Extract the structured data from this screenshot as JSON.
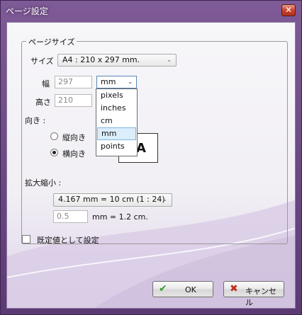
{
  "window": {
    "title": "ページ設定",
    "close_label": "✕"
  },
  "page_size": {
    "legend": "ページサイズ",
    "size_label": "サイズ",
    "size_value": "A4 :  210 x 297 mm.",
    "width_label": "幅",
    "width_value": "297",
    "height_label": "高さ",
    "height_value": "210",
    "unit_value": "mm",
    "unit_options": [
      "pixels",
      "inches",
      "cm",
      "mm",
      "points"
    ],
    "unit_selected": "mm",
    "orientation_label": "向き :",
    "portrait_label": "縦向き",
    "landscape_label": "横向き",
    "orientation_selected": "landscape",
    "preview_letter": "A",
    "scale_label": "拡大縮小 :",
    "scale_value": "4.167 mm = 10 cm (1 : 24)",
    "scale_input": "0.5",
    "scale_equation": "mm  =  1.2 cm."
  },
  "default_checkbox": {
    "label": "既定値として設定",
    "checked": false
  },
  "buttons": {
    "ok": "OK",
    "cancel": "キャンセル"
  },
  "colors": {
    "ok_icon": "#3a9a2e",
    "cancel_icon": "#c0301e",
    "title_text": "#ffffff"
  }
}
